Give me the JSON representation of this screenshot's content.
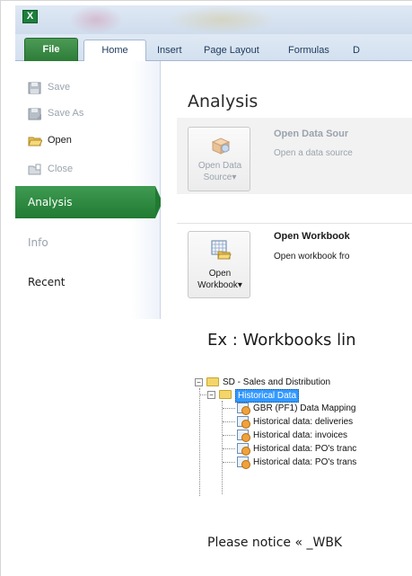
{
  "window": {
    "app_icon_letter": "X",
    "tabs": [
      {
        "id": "file",
        "label": "File"
      },
      {
        "id": "home",
        "label": "Home"
      },
      {
        "id": "insert",
        "label": "Insert"
      },
      {
        "id": "page_layout",
        "label": "Page Layout"
      },
      {
        "id": "formulas",
        "label": "Formulas"
      },
      {
        "id": "data_trunc",
        "label": "D"
      }
    ]
  },
  "backstage": {
    "menu": [
      {
        "id": "save",
        "label": "Save",
        "state": "disabled",
        "icon": "save-icon"
      },
      {
        "id": "save_as",
        "label": "Save As",
        "state": "disabled",
        "icon": "save-as-icon"
      },
      {
        "id": "open",
        "label": "Open",
        "state": "enabled",
        "icon": "open-folder-icon"
      },
      {
        "id": "close",
        "label": "Close",
        "state": "disabled",
        "icon": "close-file-icon"
      },
      {
        "id": "analysis",
        "label": "Analysis",
        "state": "selected"
      },
      {
        "id": "info",
        "label": "Info",
        "state": "disabled"
      },
      {
        "id": "recent",
        "label": "Recent",
        "state": "enabled"
      }
    ],
    "title": "Analysis",
    "blocks": [
      {
        "button_line1": "Open Data",
        "button_line2": "Source",
        "button_arrow": "▾",
        "heading": "Open Data Sour",
        "description": "Open a data source",
        "state": "disabled"
      },
      {
        "button_line1": "Open",
        "button_line2": "Workbook",
        "button_arrow": "▾",
        "heading": "Open Workbook",
        "description": "Open workbook fro",
        "state": "enabled"
      }
    ]
  },
  "document": {
    "heading": "Ex : Workbooks  lin",
    "tree": {
      "root": "SD - Sales and Distribution",
      "child": "Historical Data",
      "items": [
        "GBR (PF1) Data Mapping",
        "Historical data: deliveries",
        "Historical data: invoices",
        "Historical data: PO's tranc",
        "Historical data: PO's trans"
      ]
    },
    "notice": "Please notice « _WBK"
  },
  "colors": {
    "file_tab_green": "#2b7b37",
    "analysis_green": "#207a32",
    "selection_blue": "#3399ff",
    "ribbon_blue": "#d3e0ef"
  }
}
